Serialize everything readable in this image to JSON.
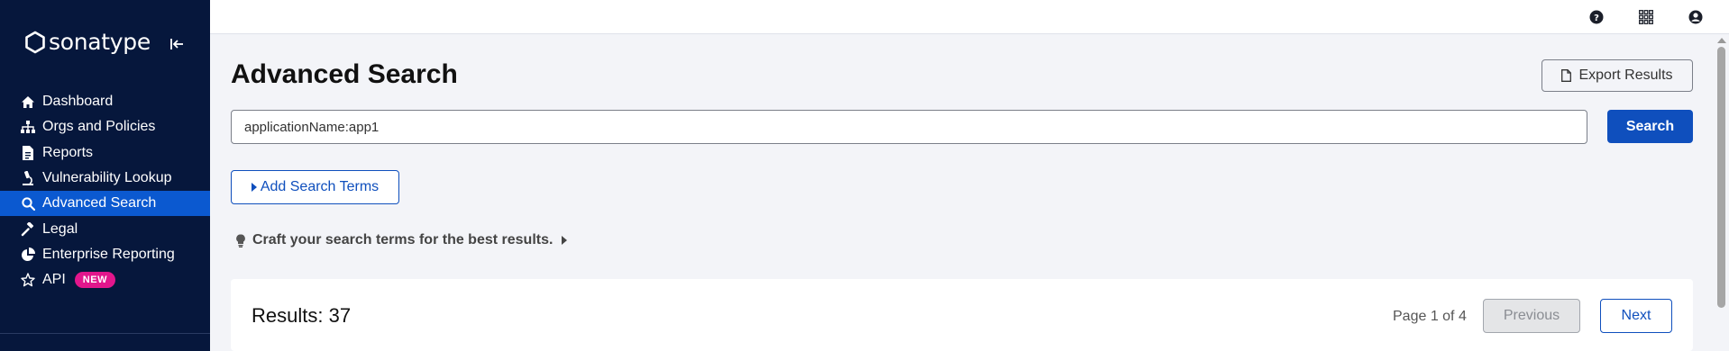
{
  "brand": {
    "name": "sonatype"
  },
  "sidebar": {
    "items": [
      {
        "label": "Dashboard",
        "icon": "home-icon"
      },
      {
        "label": "Orgs and Policies",
        "icon": "sitemap-icon"
      },
      {
        "label": "Reports",
        "icon": "report-file-icon"
      },
      {
        "label": "Vulnerability Lookup",
        "icon": "microscope-icon"
      },
      {
        "label": "Advanced Search",
        "icon": "search-icon",
        "active": true
      },
      {
        "label": "Legal",
        "icon": "gavel-icon"
      },
      {
        "label": "Enterprise Reporting",
        "icon": "pie-chart-icon"
      },
      {
        "label": "API",
        "icon": "star-outline-icon",
        "badge": "NEW"
      }
    ]
  },
  "header": {
    "icons": [
      "help-icon",
      "apps-grid-icon",
      "user-account-icon"
    ]
  },
  "main": {
    "title": "Advanced Search",
    "export_label": "Export Results",
    "search": {
      "value": "applicationName:app1",
      "button_label": "Search"
    },
    "add_terms_label": "Add Search Terms",
    "tips_label": "Craft your search terms for the best results.",
    "results": {
      "count_label": "Results: 37",
      "page_info": "Page 1 of 4",
      "previous_label": "Previous",
      "next_label": "Next"
    }
  },
  "colors": {
    "sidebar_bg": "#06173c",
    "accent": "#0f4fbd",
    "active_nav": "#0b59d0",
    "badge": "#e2168c"
  }
}
